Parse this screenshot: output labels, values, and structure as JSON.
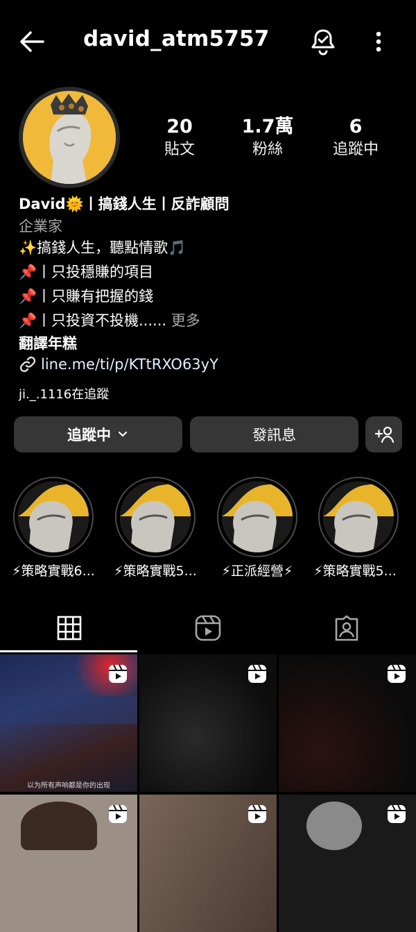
{
  "header": {
    "username": "david_atm5757",
    "back_icon": "back-arrow-icon",
    "notification_icon": "bell-check-icon",
    "more_icon": "more-vertical-icon"
  },
  "stats": [
    {
      "value": "20",
      "label": "貼文"
    },
    {
      "value": "1.7萬",
      "label": "粉絲"
    },
    {
      "value": "6",
      "label": "追蹤中"
    }
  ],
  "bio": {
    "name": "David🌞丨搞錢人生丨反詐顧問",
    "category": "企業家",
    "lines": [
      "✨搞錢人生，聽點情歌🎵",
      "丨只投穩賺的項目",
      "丨只賺有把握的錢",
      "丨只投資不投機......"
    ],
    "pin": "📌",
    "more": "更多",
    "translate": "翻譯年糕",
    "link": "line.me/ti/p/KTtRXO63yY",
    "followed_by": "ji._.1116在追蹤"
  },
  "actions": {
    "following": "追蹤中",
    "message": "發訊息",
    "add_icon": "add-person-icon"
  },
  "highlights": [
    {
      "label": "⚡策略實戰6..."
    },
    {
      "label": "⚡策略實戰5..."
    },
    {
      "label": "⚡正派經營⚡"
    },
    {
      "label": "⚡策略實戰5..."
    }
  ],
  "tabs": [
    {
      "icon": "grid-icon",
      "selected": true
    },
    {
      "icon": "reels-icon",
      "selected": false
    },
    {
      "icon": "tagged-icon",
      "selected": false
    }
  ],
  "grid_caption": "以为所有声响都是你的出现",
  "colors": {
    "background": "#000000",
    "button": "#363636",
    "muted": "#a8a8a8",
    "highlight_bg": "#e8b42a"
  }
}
